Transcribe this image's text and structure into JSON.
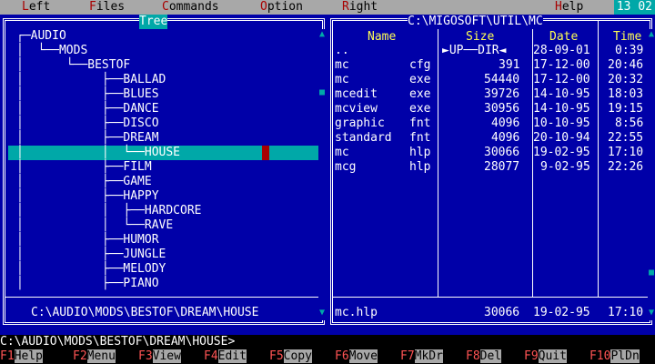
{
  "menu": {
    "items": [
      {
        "hotkey": "L",
        "rest": "eft"
      },
      {
        "hotkey": "F",
        "rest": "iles"
      },
      {
        "hotkey": "C",
        "rest": "ommands"
      },
      {
        "hotkey": "O",
        "rest": "ption"
      },
      {
        "hotkey": "R",
        "rest": "ight"
      },
      {
        "hotkey": "H",
        "rest": "elp"
      }
    ],
    "clock": "13 02"
  },
  "tree_panel": {
    "title": "Tree",
    "lines": [
      "┌─AUDIO",
      "│  └──MODS",
      "│      └──BESTOF",
      "│           ├──BALLAD",
      "│           ├──BLUES",
      "│           ├──DANCE",
      "│           ├──DISCO",
      "│           ├──DREAM",
      "│           │  └──HOUSE",
      "│           ├──FILM",
      "│           ├──GAME",
      "│           ├──HAPPY",
      "│           │  ├──HARDCORE",
      "│           │  └──RAVE",
      "│           ├──HUMOR",
      "│           ├──JUNGLE",
      "│           ├──MELODY",
      "│           ├──PIANO"
    ],
    "selected_line": 8,
    "path": "C:\\AUDIO\\MODS\\BESTOF\\DREAM\\HOUSE"
  },
  "file_panel": {
    "path": "C:\\MIGOSOFT\\UTIL\\MC",
    "headers": {
      "name": "Name",
      "size": "Size",
      "date": "Date",
      "time": "Time"
    },
    "rows": [
      {
        "name": "..",
        "ext": "",
        "size": "►UP──DIR◄",
        "date": "28-09-01",
        "time": "0:39"
      },
      {
        "name": "mc",
        "ext": "cfg",
        "size": "391",
        "date": "17-12-00",
        "time": "20:46"
      },
      {
        "name": "mc",
        "ext": "exe",
        "size": "54440",
        "date": "17-12-00",
        "time": "20:32"
      },
      {
        "name": "mcedit",
        "ext": "exe",
        "size": "39726",
        "date": "14-10-95",
        "time": "18:03"
      },
      {
        "name": "mcview",
        "ext": "exe",
        "size": "30956",
        "date": "14-10-95",
        "time": "19:15"
      },
      {
        "name": "graphic",
        "ext": "fnt",
        "size": "4096",
        "date": "10-10-95",
        "time": "8:56"
      },
      {
        "name": "standard",
        "ext": "fnt",
        "size": "4096",
        "date": "20-10-94",
        "time": "22:55"
      },
      {
        "name": "mc",
        "ext": "hlp",
        "size": "30066",
        "date": "19-02-95",
        "time": "17:10"
      },
      {
        "name": "mcg",
        "ext": "hlp",
        "size": "28077",
        "date": "9-02-95",
        "time": "22:26"
      }
    ],
    "status": {
      "name": "mc.hlp",
      "size": "30066",
      "date": "19-02-95",
      "time": "17:10"
    }
  },
  "command_line": "C:\\AUDIO\\MODS\\BESTOF\\DREAM\\HOUSE>",
  "function_keys": [
    {
      "num": "F1",
      "label": "Help"
    },
    {
      "num": "F2",
      "label": "Menu"
    },
    {
      "num": "F3",
      "label": "View"
    },
    {
      "num": "F4",
      "label": "Edit"
    },
    {
      "num": "F5",
      "label": "Copy"
    },
    {
      "num": "F6",
      "label": "Move"
    },
    {
      "num": "F7",
      "label": "MkDr"
    },
    {
      "num": "F8",
      "label": "Del"
    },
    {
      "num": "F9",
      "label": "Quit"
    },
    {
      "num": "F10",
      "label": "PlDn"
    }
  ]
}
